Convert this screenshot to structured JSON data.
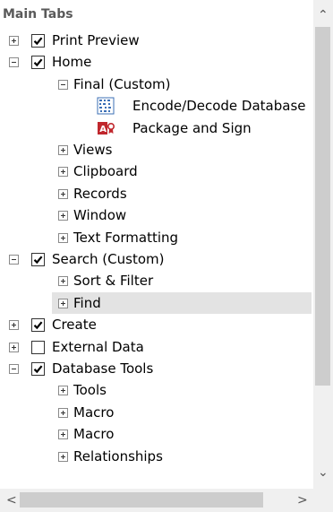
{
  "header": {
    "title": "Main Tabs"
  },
  "tree": [
    {
      "label": "Print Preview",
      "level": 0,
      "expander": "plus",
      "checked": true
    },
    {
      "label": "Home",
      "level": 0,
      "expander": "minus",
      "checked": true
    },
    {
      "label": "Final (Custom)",
      "level": 1,
      "expander": "minus"
    },
    {
      "label": "Encode/Decode Database",
      "level": 2,
      "icon": "encode-decode-icon"
    },
    {
      "label": "Package and Sign",
      "level": 2,
      "icon": "package-sign-icon"
    },
    {
      "label": "Views",
      "level": 1,
      "expander": "plus"
    },
    {
      "label": "Clipboard",
      "level": 1,
      "expander": "plus"
    },
    {
      "label": "Records",
      "level": 1,
      "expander": "plus"
    },
    {
      "label": "Window",
      "level": 1,
      "expander": "plus"
    },
    {
      "label": "Text Formatting",
      "level": 1,
      "expander": "plus"
    },
    {
      "label": "Search (Custom)",
      "level": 0,
      "expander": "minus",
      "checked": true
    },
    {
      "label": "Sort & Filter",
      "level": 1,
      "expander": "plus"
    },
    {
      "label": "Find",
      "level": 1,
      "expander": "plus",
      "selected": true
    },
    {
      "label": "Create",
      "level": 0,
      "expander": "plus",
      "checked": true
    },
    {
      "label": "External Data",
      "level": 0,
      "expander": "plus",
      "checked": false
    },
    {
      "label": "Database Tools",
      "level": 0,
      "expander": "minus",
      "checked": true
    },
    {
      "label": "Tools",
      "level": 1,
      "expander": "plus"
    },
    {
      "label": "Macro",
      "level": 1,
      "expander": "plus"
    },
    {
      "label": "Macro",
      "level": 1,
      "expander": "plus"
    },
    {
      "label": "Relationships",
      "level": 1,
      "expander": "plus"
    }
  ],
  "scrollbars": {
    "up_arrow": "⌃",
    "down_arrow": "⌄",
    "left_arrow": "<",
    "right_arrow": ">"
  }
}
